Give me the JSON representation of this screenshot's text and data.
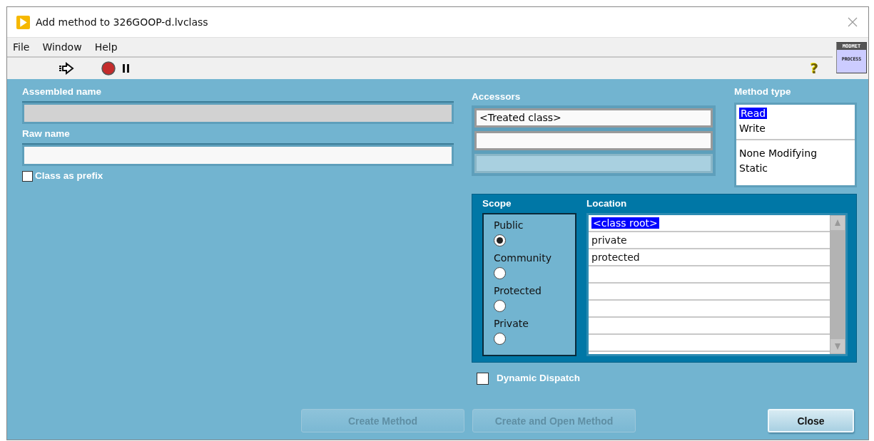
{
  "window": {
    "title": "Add method to 326GOOP-d.lvclass"
  },
  "menu": [
    {
      "label": "File"
    },
    {
      "label": "Window"
    },
    {
      "label": "Help"
    }
  ],
  "toolbar": {
    "help_glyph": "?",
    "vi_icon": {
      "header": "MODMET",
      "body": "PROCESS"
    }
  },
  "names": {
    "assembled_label": "Assembled name",
    "raw_label": "Raw name",
    "class_prefix": {
      "label": "Class as prefix",
      "checked": false
    }
  },
  "accessors": {
    "label": "Accessors",
    "fields": [
      {
        "value": "<Treated class>",
        "disabled": false
      },
      {
        "disabled": false
      },
      {
        "disabled": true
      }
    ]
  },
  "method_type": {
    "label": "Method type",
    "groups": [
      [
        {
          "label": "Read",
          "selected": true
        },
        {
          "label": "Write",
          "selected": false
        }
      ],
      [
        {
          "label": "None Modifying",
          "selected": false
        },
        {
          "label": "Static",
          "selected": false
        }
      ]
    ]
  },
  "scope": {
    "label": "Scope",
    "options": [
      {
        "label": "Public",
        "selected": true
      },
      {
        "label": "Community",
        "selected": false
      },
      {
        "label": "Protected",
        "selected": false
      },
      {
        "label": "Private",
        "selected": false
      }
    ]
  },
  "location": {
    "label": "Location",
    "items": [
      {
        "label": "<class root>",
        "selected": true
      },
      {
        "label": "private",
        "selected": false
      },
      {
        "label": "protected",
        "selected": false
      }
    ]
  },
  "dynamic_dispatch": {
    "label": "Dynamic Dispatch",
    "checked": false
  },
  "buttons": [
    {
      "label": "Create Method",
      "disabled": true,
      "kind": "action"
    },
    {
      "label": "Create and Open Method",
      "disabled": true,
      "kind": "action"
    },
    {
      "label": "Close",
      "disabled": false,
      "kind": "close"
    }
  ]
}
